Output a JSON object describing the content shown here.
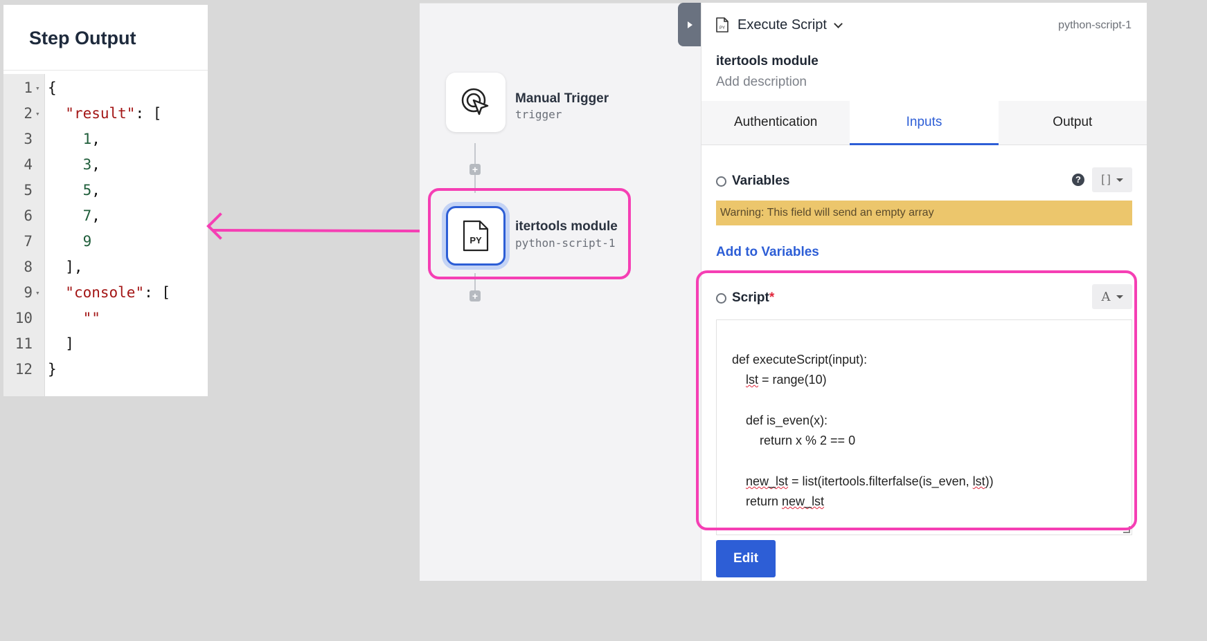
{
  "step_output": {
    "title": "Step Output",
    "lines": [
      {
        "num": "1",
        "fold": true,
        "html": "{"
      },
      {
        "num": "2",
        "fold": true,
        "key": "\"result\"",
        "rest": ": ["
      },
      {
        "num": "3",
        "num_val": "1",
        "rest": ","
      },
      {
        "num": "4",
        "num_val": "3",
        "rest": ","
      },
      {
        "num": "5",
        "num_val": "5",
        "rest": ","
      },
      {
        "num": "6",
        "num_val": "7",
        "rest": ","
      },
      {
        "num": "7",
        "num_val": "9",
        "rest": ""
      },
      {
        "num": "8",
        "plain": "  ],"
      },
      {
        "num": "9",
        "fold": true,
        "key": "\"console\"",
        "rest": ": ["
      },
      {
        "num": "10",
        "str_val": "\"\""
      },
      {
        "num": "11",
        "plain": "  ]"
      },
      {
        "num": "12",
        "plain": "}"
      }
    ]
  },
  "workflow": {
    "trigger": {
      "title": "Manual Trigger",
      "subtitle": "trigger"
    },
    "script_node": {
      "title": "itertools module",
      "subtitle": "python-script-1",
      "icon_text": "PY"
    }
  },
  "panel": {
    "title": "Execute Script",
    "node_id": "python-script-1",
    "name": "itertools module",
    "description_placeholder": "Add description",
    "tabs": [
      {
        "label": "Authentication",
        "active": false
      },
      {
        "label": "Inputs",
        "active": true
      },
      {
        "label": "Output",
        "active": false
      }
    ],
    "variables": {
      "label": "Variables",
      "type_button": "[ ]",
      "warning": "Warning: This field will send an empty array",
      "add_link": "Add to Variables"
    },
    "script": {
      "label": "Script",
      "required_mark": "*",
      "type_button": "A",
      "code": [
        "def executeScript(input):",
        "    lst = range(10)",
        "",
        "    def is_even(x):",
        "        return x % 2 == 0",
        "",
        "    new_lst = list(itertools.filterfalse(is_even, lst))",
        "    return new_lst"
      ]
    },
    "edit_button": "Edit"
  },
  "colors": {
    "accent": "#2d5ed6",
    "highlight": "#f53fb4",
    "warning_bg": "#ecc66c"
  }
}
